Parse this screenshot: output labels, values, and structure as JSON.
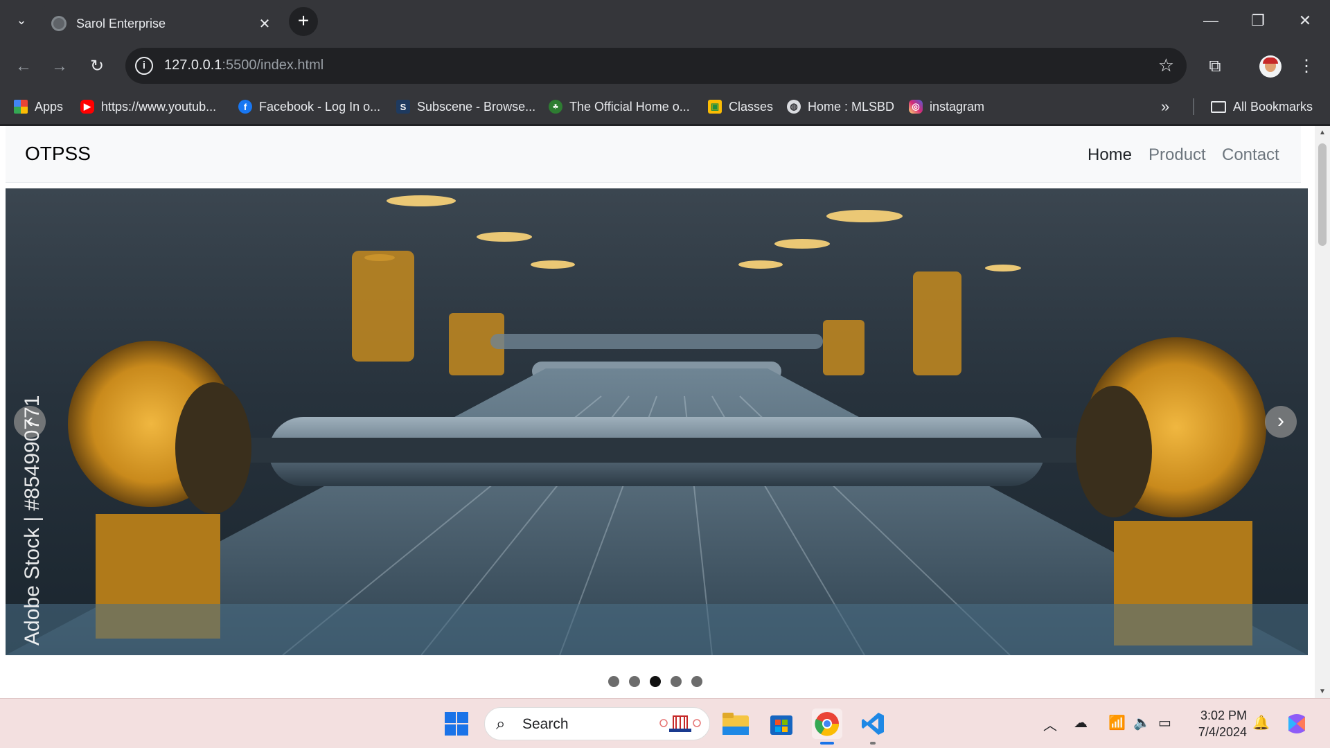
{
  "browser": {
    "tab": {
      "title": "Sarol Enterprise"
    },
    "url_host": "127.0.0.1",
    "url_rest": ":5500/index.html",
    "bookmarks": [
      {
        "label": "Apps",
        "icon": "apps-grid-icon"
      },
      {
        "label": "https://www.youtub...",
        "icon": "youtube-icon"
      },
      {
        "label": "Facebook - Log In o...",
        "icon": "facebook-icon"
      },
      {
        "label": "Subscene - Browse...",
        "icon": "subscene-icon"
      },
      {
        "label": "The Official Home o...",
        "icon": "official-home-icon"
      },
      {
        "label": "Classes",
        "icon": "classroom-icon"
      },
      {
        "label": "Home : MLSBD",
        "icon": "globe-icon"
      },
      {
        "label": "instagram",
        "icon": "instagram-icon"
      }
    ],
    "all_bookmarks": "All Bookmarks"
  },
  "site": {
    "brand": "OTPSS",
    "nav": [
      {
        "label": "Home",
        "active": true
      },
      {
        "label": "Product",
        "active": false
      },
      {
        "label": "Contact",
        "active": false
      }
    ],
    "carousel": {
      "watermark": "Adobe Stock | #854990771",
      "slide_count": 5,
      "active_index": 2
    }
  },
  "taskbar": {
    "search_placeholder": "Search",
    "time": "3:02 PM",
    "date": "7/4/2024"
  },
  "colors": {
    "chrome_dark": "#35363a",
    "omnibox": "#202124",
    "taskbar": "#f3e0e0",
    "navbar_bg": "#f8f9fa"
  }
}
